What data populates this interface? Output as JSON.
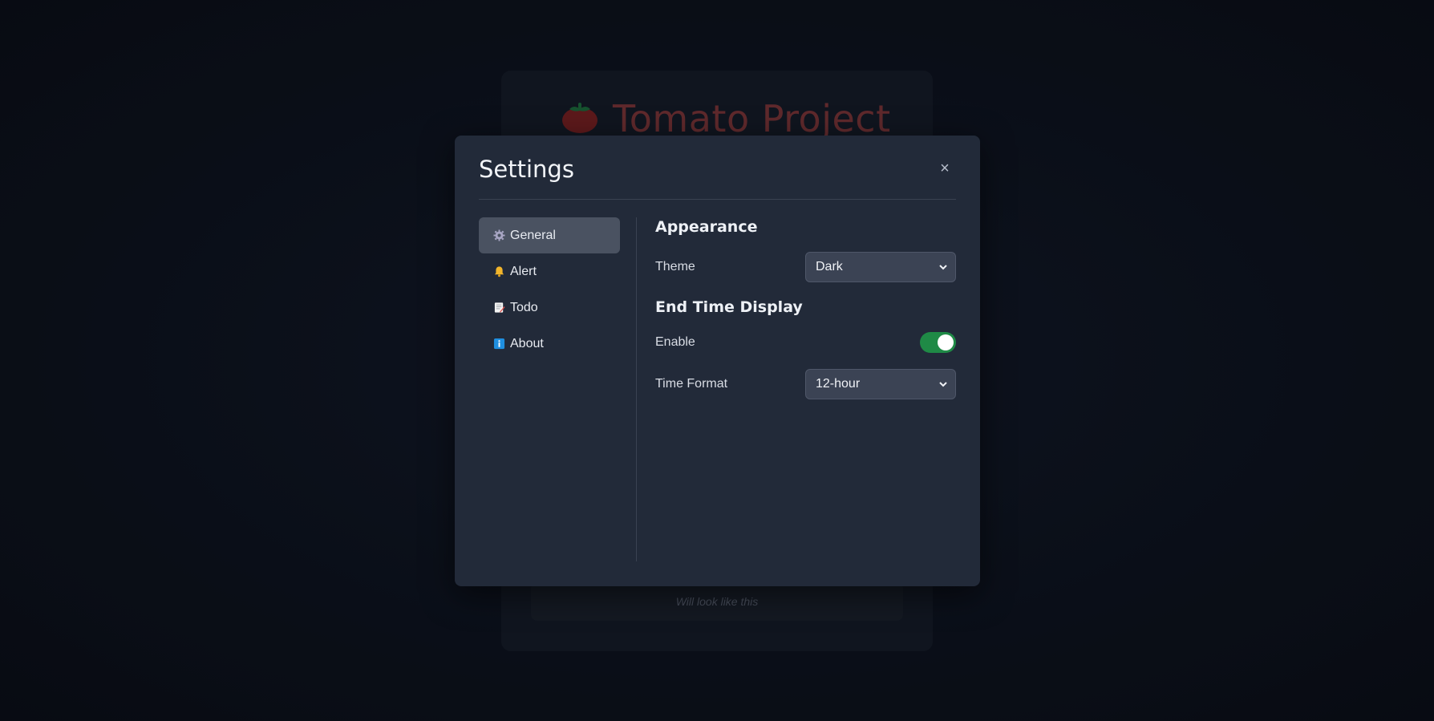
{
  "background_app": {
    "title": "Tomato Project",
    "preview_text": "Will look like this",
    "brand_color": "#7e3436"
  },
  "modal": {
    "title": "Settings",
    "close_label": "×",
    "sidebar": {
      "items": [
        {
          "label": "General",
          "icon": "gear-icon",
          "active": true
        },
        {
          "label": "Alert",
          "icon": "bell-icon",
          "active": false
        },
        {
          "label": "Todo",
          "icon": "memo-icon",
          "active": false
        },
        {
          "label": "About",
          "icon": "info-icon",
          "active": false
        }
      ]
    },
    "appearance": {
      "section_title": "Appearance",
      "theme_label": "Theme",
      "theme_value": "Dark"
    },
    "end_time_display": {
      "section_title": "End Time Display",
      "enable_label": "Enable",
      "enable_value": true,
      "time_format_label": "Time Format",
      "time_format_value": "12-hour"
    }
  },
  "colors": {
    "modal_bg": "#222a39",
    "active_item_bg": "#4a5261",
    "toggle_on": "#1f8a46",
    "select_bg": "#3b4354"
  }
}
